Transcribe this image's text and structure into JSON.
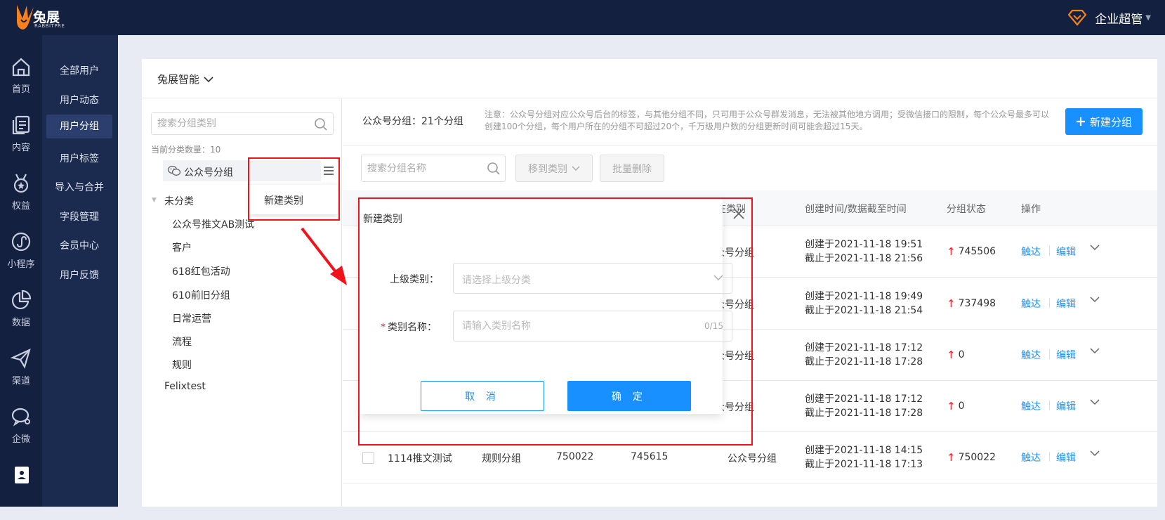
{
  "brand": {
    "name": "兔展",
    "sub": "RABBITPRE"
  },
  "user": {
    "role": "企业超管"
  },
  "iconbar": [
    {
      "label": "首页",
      "icon": "home-icon"
    },
    {
      "label": "内容",
      "icon": "content-icon"
    },
    {
      "label": "权益",
      "icon": "medal-icon"
    },
    {
      "label": "小程序",
      "icon": "mini-program-icon"
    },
    {
      "label": "数据",
      "icon": "pie-chart-icon"
    },
    {
      "label": "渠道",
      "icon": "send-icon"
    },
    {
      "label": "企微",
      "icon": "wecom-icon"
    }
  ],
  "subnav": [
    "全部用户",
    "用户动态",
    "用户分组",
    "用户标签",
    "导入与合并",
    "字段管理",
    "会员中心",
    "用户反馈"
  ],
  "org": {
    "name": "兔展智能"
  },
  "left": {
    "search_placeholder": "搜索分组类别",
    "count": "当前分类数量：10",
    "selected": "公众号分组",
    "uncategorized": "未分类",
    "children": [
      "公众号推文AB测试",
      "客户",
      "618红包活动",
      "610前旧分组",
      "日常运营",
      "流程",
      "规则"
    ],
    "other": "Felixtest",
    "menu_item": "新建类别"
  },
  "right": {
    "title": "公众号分组：21个分组",
    "note": "注意：公众号分组对应公众号后台的标签，与其他分组不同，只可用于公众号群发消息，无法被其他地方调用；受微信接口的限制，每个公众号最多可以创建100个分组，每个用户所在的分组不可超过20个，千万级用户数的分组更新时间可能会超过15天。",
    "new_btn": "新建分组",
    "search_placeholder": "搜索分组名称",
    "move_btn": "移到类别",
    "batch_delete": "批量删除",
    "headers": {
      "category": "在类别",
      "time": "创建时间/数据截至时间",
      "status": "分组状态",
      "ops": "操作"
    },
    "rows": [
      {
        "name": "",
        "type": "",
        "a": "",
        "b": "",
        "category": "众号分组",
        "created": "创建于2021-11-18 19:51",
        "until": "截止于2021-11-18 21:56",
        "status": "745506"
      },
      {
        "name": "",
        "type": "",
        "a": "",
        "b": "",
        "category": "众号分组",
        "created": "创建于2021-11-18 19:49",
        "until": "截止于2021-11-18 21:54",
        "status": "737498"
      },
      {
        "name": "",
        "type": "",
        "a": "",
        "b": "",
        "category": "众号分组",
        "created": "创建于2021-11-18 17:12",
        "until": "截止于2021-11-18 17:28",
        "status": "0"
      },
      {
        "name": "",
        "type": "",
        "a": "",
        "b": "",
        "category": "众号分组",
        "created": "创建于2021-11-18 17:12",
        "until": "截止于2021-11-18 17:28",
        "status": "0"
      },
      {
        "name": "1114推文测试",
        "type": "规则分组",
        "a": "750022",
        "b": "745615",
        "category": "公众号分组",
        "created": "创建于2021-11-18 14:15",
        "until": "截止于2021-11-18 17:13",
        "status": "750022"
      }
    ],
    "op_reach": "触达",
    "op_edit": "编辑"
  },
  "modal": {
    "title": "新建类别",
    "parent_label": "上级类别：",
    "parent_placeholder": "请选择上级分类",
    "name_label": "类别名称：",
    "name_placeholder": "请输入类别名称",
    "counter": "0/15",
    "cancel": "取 消",
    "ok": "确 定"
  },
  "colors": {
    "primary": "#1890ff",
    "nav_bg": "#142040",
    "highlight": "#f0131b",
    "accent": "#f5821f"
  }
}
